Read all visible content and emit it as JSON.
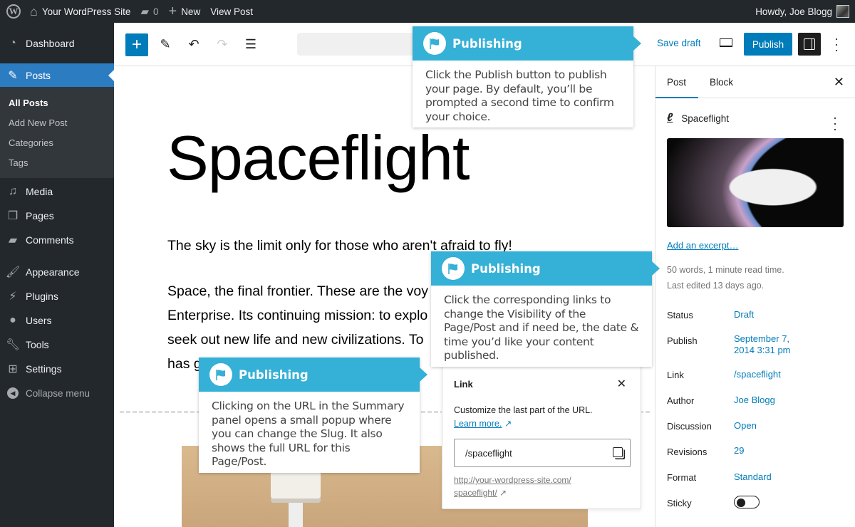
{
  "admin_bar": {
    "site_name": "Your WordPress Site",
    "comments_count": "0",
    "new_label": "New",
    "view_post_label": "View Post",
    "greeting": "Howdy, Joe Blogg"
  },
  "sidebar": {
    "items": [
      {
        "label": "Dashboard",
        "icon": "dashboard-icon"
      },
      {
        "label": "Posts",
        "icon": "pin-icon",
        "current": true
      },
      {
        "label": "Media",
        "icon": "media-icon"
      },
      {
        "label": "Pages",
        "icon": "pages-icon"
      },
      {
        "label": "Comments",
        "icon": "comment-icon"
      },
      {
        "label": "Appearance",
        "icon": "brush-icon"
      },
      {
        "label": "Plugins",
        "icon": "plugin-icon"
      },
      {
        "label": "Users",
        "icon": "user-icon"
      },
      {
        "label": "Tools",
        "icon": "wrench-icon"
      },
      {
        "label": "Settings",
        "icon": "settings-icon"
      }
    ],
    "submenu": [
      "All Posts",
      "Add New Post",
      "Categories",
      "Tags"
    ],
    "collapse_label": "Collapse menu"
  },
  "toolbar": {
    "save_draft": "Save draft",
    "publish": "Publish"
  },
  "editor": {
    "title": "Spaceflight",
    "paragraph1": "The sky is the limit only for those who aren't afraid to fly!",
    "paragraph2_lines": [
      "Space, the final frontier. These are the voy",
      "Enterprise. Its continuing mission: to explo",
      "seek out new life and new civilizations. To",
      "has g"
    ]
  },
  "inspector": {
    "tabs": [
      "Post",
      "Block"
    ],
    "active_tab": "Post",
    "post_title": "Spaceflight",
    "excerpt_link": "Add an excerpt…",
    "word_count": "50 words, 1 minute read time.",
    "last_edited": "Last edited 13 days ago.",
    "rows": [
      {
        "label": "Status",
        "value": "Draft"
      },
      {
        "label": "Publish",
        "value": "September 7,\n2014 3:31 pm"
      },
      {
        "label": "Link",
        "value": "/spaceflight"
      },
      {
        "label": "Author",
        "value": "Joe Blogg"
      },
      {
        "label": "Discussion",
        "value": "Open"
      },
      {
        "label": "Revisions",
        "value": "29"
      },
      {
        "label": "Format",
        "value": "Standard"
      },
      {
        "label": "Sticky",
        "value": "off"
      }
    ]
  },
  "link_popover": {
    "title": "Link",
    "description": "Customize the last part of the URL.",
    "learn_more": "Learn more.",
    "slug_value": "/spaceflight",
    "full_url_line1": "http://your-wordpress-site.com/",
    "full_url_line2": "spaceflight/"
  },
  "callouts": [
    {
      "title": "Publishing",
      "body": "Click the Publish button to publish your page. By default, you’ll be prompted a second time to confirm your choice."
    },
    {
      "title": "Publishing",
      "body": "Click the corresponding links to change the Visibility of the Page/Post and if need be, the date & time you’d like your content published."
    },
    {
      "title": "Publishing",
      "body": "Clicking on the URL in the Summary panel opens a small popup where you can change the Slug. It also shows the full URL for this Page/Post."
    }
  ],
  "colors": {
    "admin_bg": "#23282d",
    "accent": "#007cba",
    "menu_current": "#2c7cc1",
    "callout": "#35b0d6"
  }
}
